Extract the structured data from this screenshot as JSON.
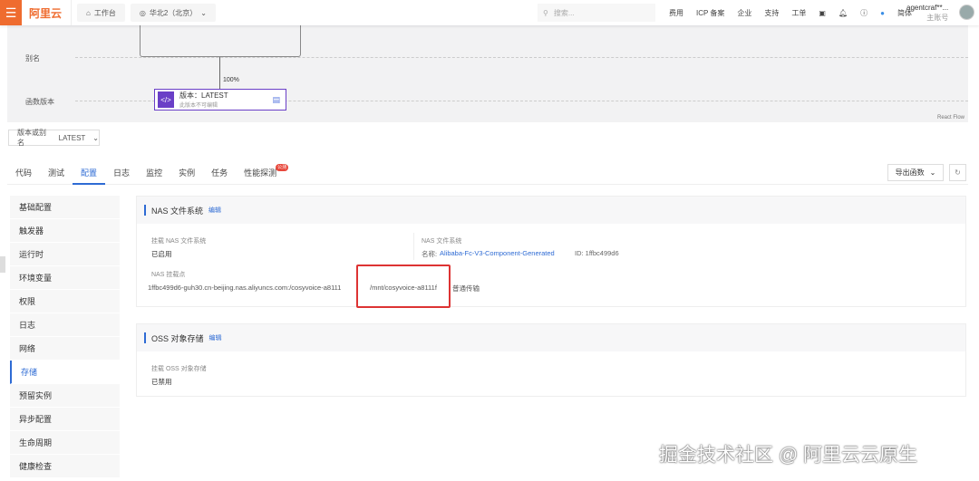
{
  "header": {
    "logo": "阿里云",
    "workbench": "工作台",
    "region": "华北2（北京）",
    "search_placeholder": "搜索...",
    "nav": [
      "费用",
      "ICP 备案",
      "企业",
      "支持",
      "工单"
    ],
    "lang": "简体",
    "user": "agentcraf**...",
    "role": "主账号"
  },
  "flow": {
    "alias_label": "别名",
    "version_label": "函数版本",
    "percent": "100%",
    "node_title": "版本：LATEST",
    "node_sub": "此版本不可编辑",
    "credit": "React Flow"
  },
  "version_select": {
    "label": "版本或别名",
    "value": "LATEST"
  },
  "tabs": [
    {
      "label": "代码"
    },
    {
      "label": "测试"
    },
    {
      "label": "配置"
    },
    {
      "label": "日志"
    },
    {
      "label": "监控"
    },
    {
      "label": "实例"
    },
    {
      "label": "任务"
    },
    {
      "label": "性能探测",
      "badge": "公测"
    }
  ],
  "export_label": "导出函数",
  "sidebar": [
    "基础配置",
    "触发器",
    "运行时",
    "环境变量",
    "权限",
    "日志",
    "网络",
    "存储",
    "预留实例",
    "异步配置",
    "生命周期",
    "健康检查"
  ],
  "nas": {
    "title": "NAS 文件系统",
    "edit": "编辑",
    "mount_label": "挂载 NAS 文件系统",
    "mount_value": "已启用",
    "fs_label": "NAS 文件系统",
    "name_label": "名称:",
    "name_value": "Alibaba-Fc-V3-Component-Generated",
    "id": "ID: 1ffbc499d6",
    "mount_point_label": "NAS 挂载点",
    "mount_point": "1ffbc499d6-guh30.cn-beijing.nas.aliyuncs.com:/cosyvoice-a8111",
    "local_path": "/mnt/cosyvoice-a8111f",
    "transfer": "普通传输"
  },
  "oss": {
    "title": "OSS 对象存储",
    "edit": "编辑",
    "mount_label": "挂载 OSS 对象存储",
    "mount_value": "已禁用"
  },
  "watermark": "掘金技术社区 @ 阿里云云原生"
}
